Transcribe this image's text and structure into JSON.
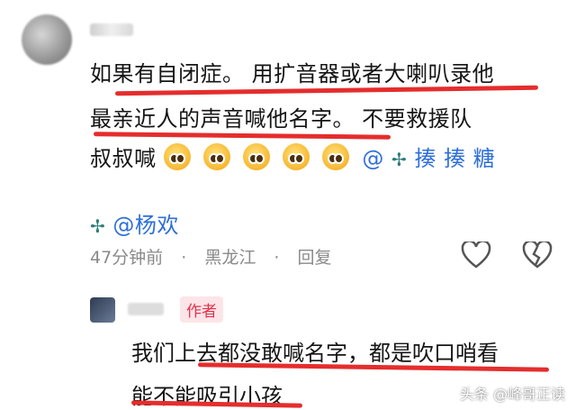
{
  "comment": {
    "line1": "如果有自闭症。 用扩音器或者大喇叭录他",
    "line2": "最亲近人的声音喊他名字。  不要救援队",
    "line3_text": "叔叔喊",
    "line3_tail": "@",
    "tag1": "揍",
    "tag2": "揍",
    "tag3": "糖",
    "mention": "@杨欢",
    "time": "47分钟前",
    "location": "黑龙江",
    "reply_action": "回复"
  },
  "reply": {
    "author_badge": "作者",
    "line1": "我们上去都没敢喊名字，都是吹口哨看",
    "line2": "能不能吸引小孩"
  },
  "watermark": "头条 @峰哥正读",
  "colors": {
    "underline": "#e52d2d",
    "badge": "#e0334d"
  }
}
